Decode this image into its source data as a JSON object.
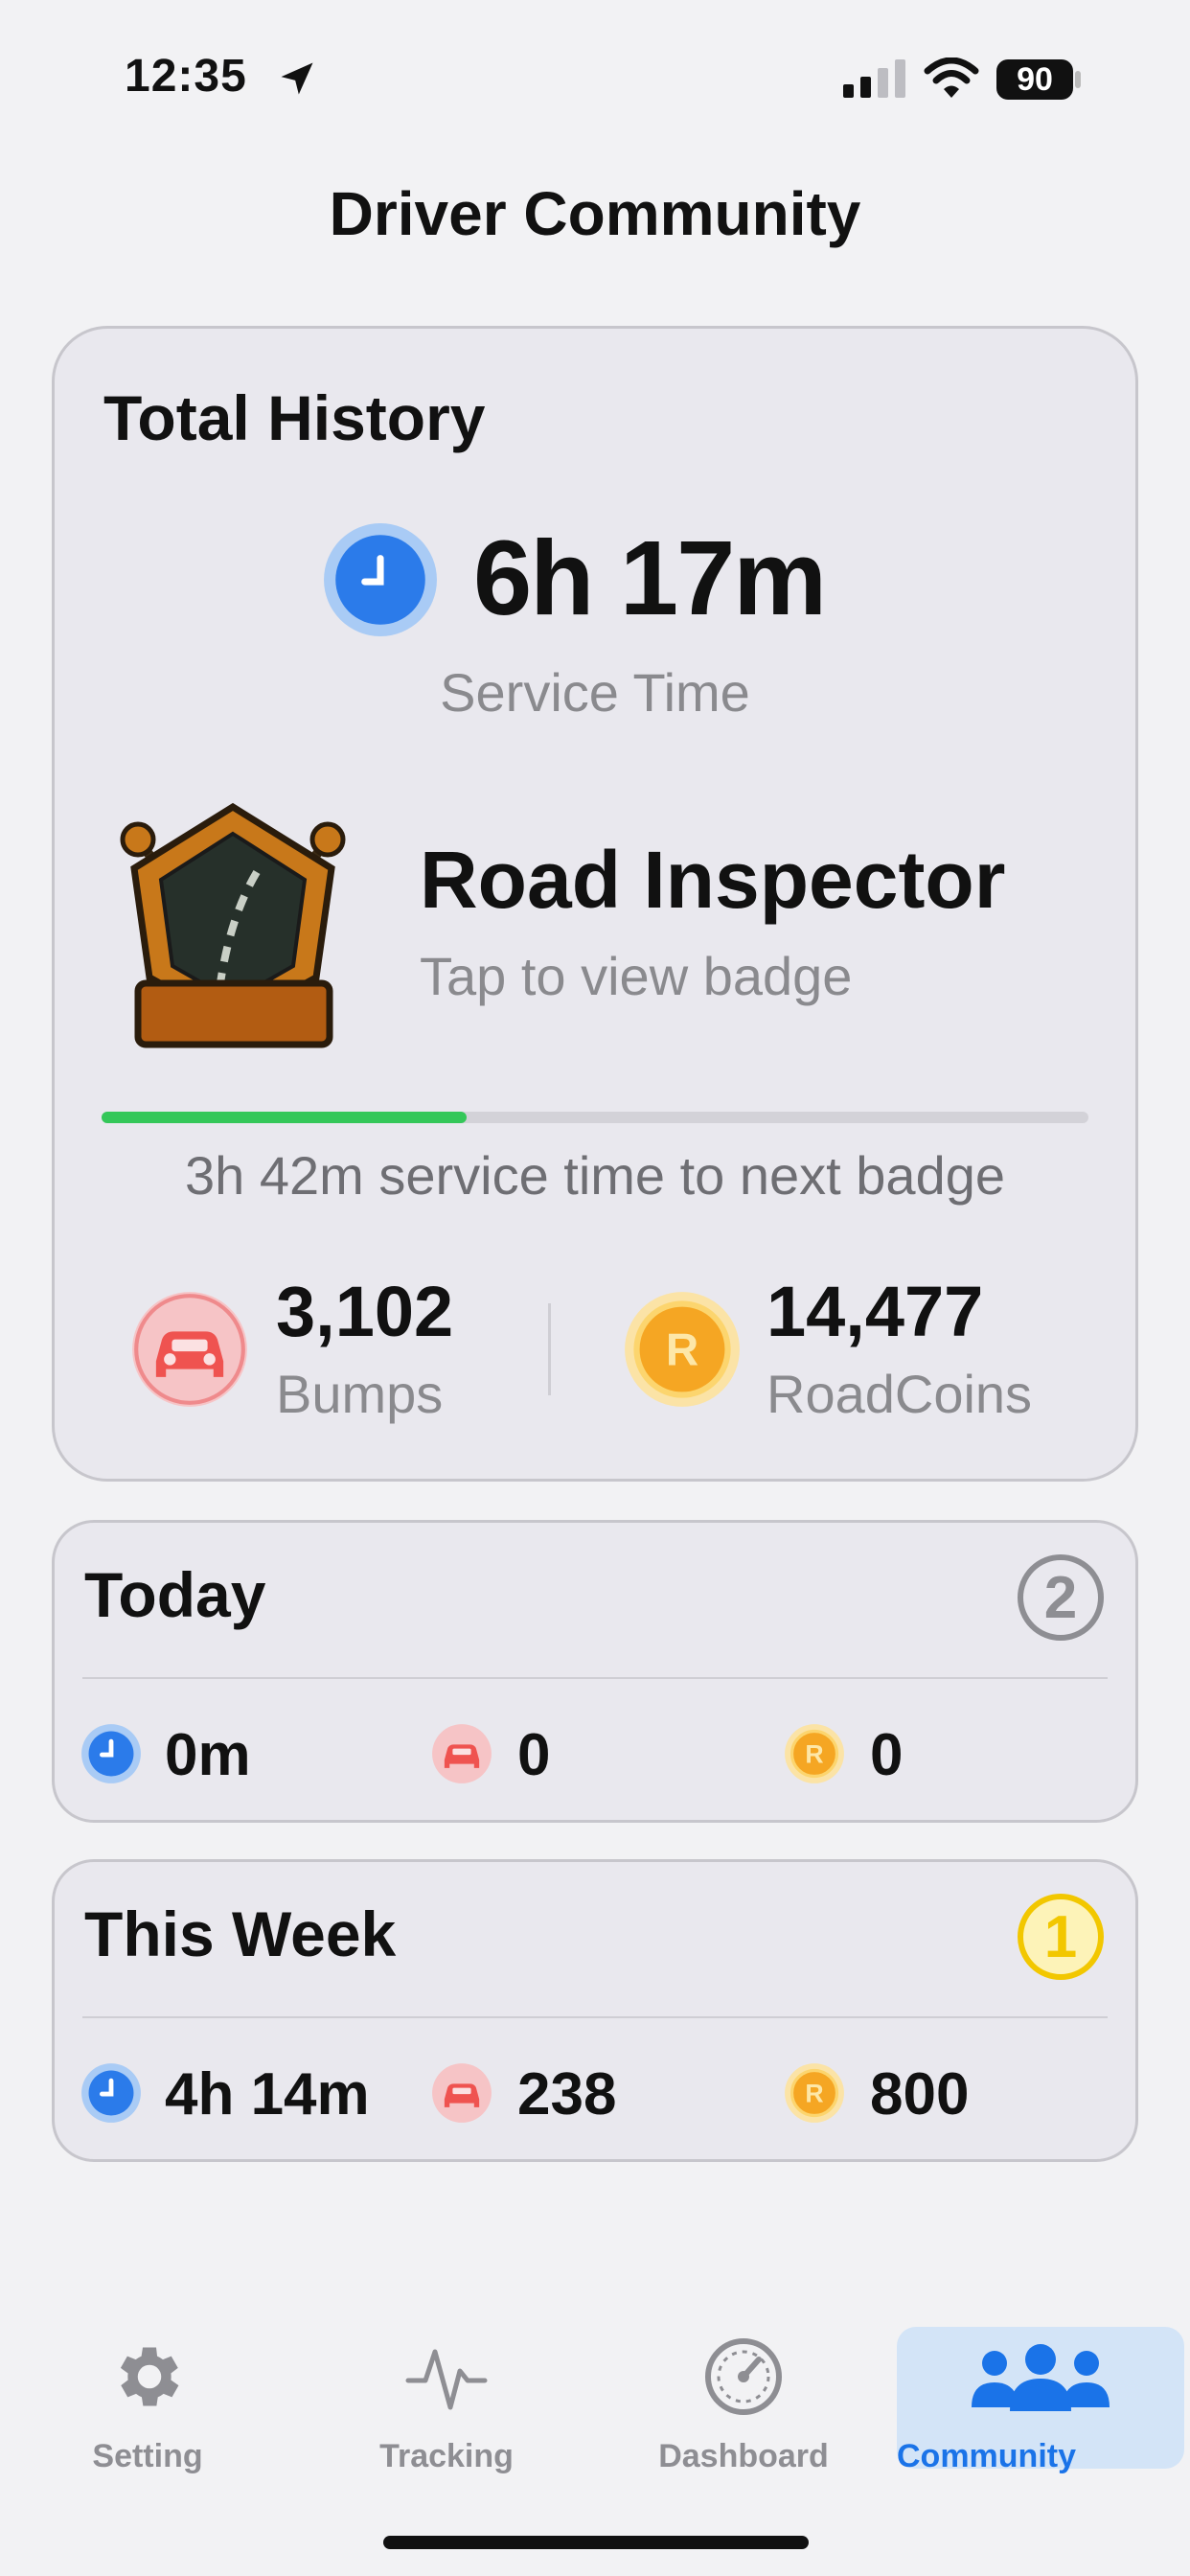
{
  "status_bar": {
    "time": "12:35",
    "battery": "90"
  },
  "page_title": "Driver Community",
  "total_history": {
    "title": "Total History",
    "service_time": "6h 17m",
    "service_label": "Service Time",
    "badge": {
      "name": "Road Inspector",
      "subtitle": "Tap to view badge"
    },
    "progress": {
      "fraction": 0.37,
      "label": "3h 42m service time to next badge"
    },
    "bumps": {
      "value": "3,102",
      "label": "Bumps"
    },
    "roadcoins": {
      "value": "14,477",
      "label": "RoadCoins",
      "coin_letter": "R"
    }
  },
  "today": {
    "title": "Today",
    "rank": "2",
    "time": "0m",
    "bumps": "0",
    "coins": "0"
  },
  "this_week": {
    "title": "This Week",
    "rank": "1",
    "time": "4h 14m",
    "bumps": "238",
    "coins": "800"
  },
  "tabs": [
    {
      "label": "Setting",
      "icon": "gear-icon"
    },
    {
      "label": "Tracking",
      "icon": "activity-icon"
    },
    {
      "label": "Dashboard",
      "icon": "gauge-icon"
    },
    {
      "label": "Community",
      "icon": "people-icon",
      "active": true
    }
  ],
  "colors": {
    "accent": "#1a73e8",
    "progress": "#34c759",
    "clock": "#2b7bea",
    "bumps": "#ef5350",
    "coin": "#f5a623",
    "gold_rank": "#f2c700"
  }
}
